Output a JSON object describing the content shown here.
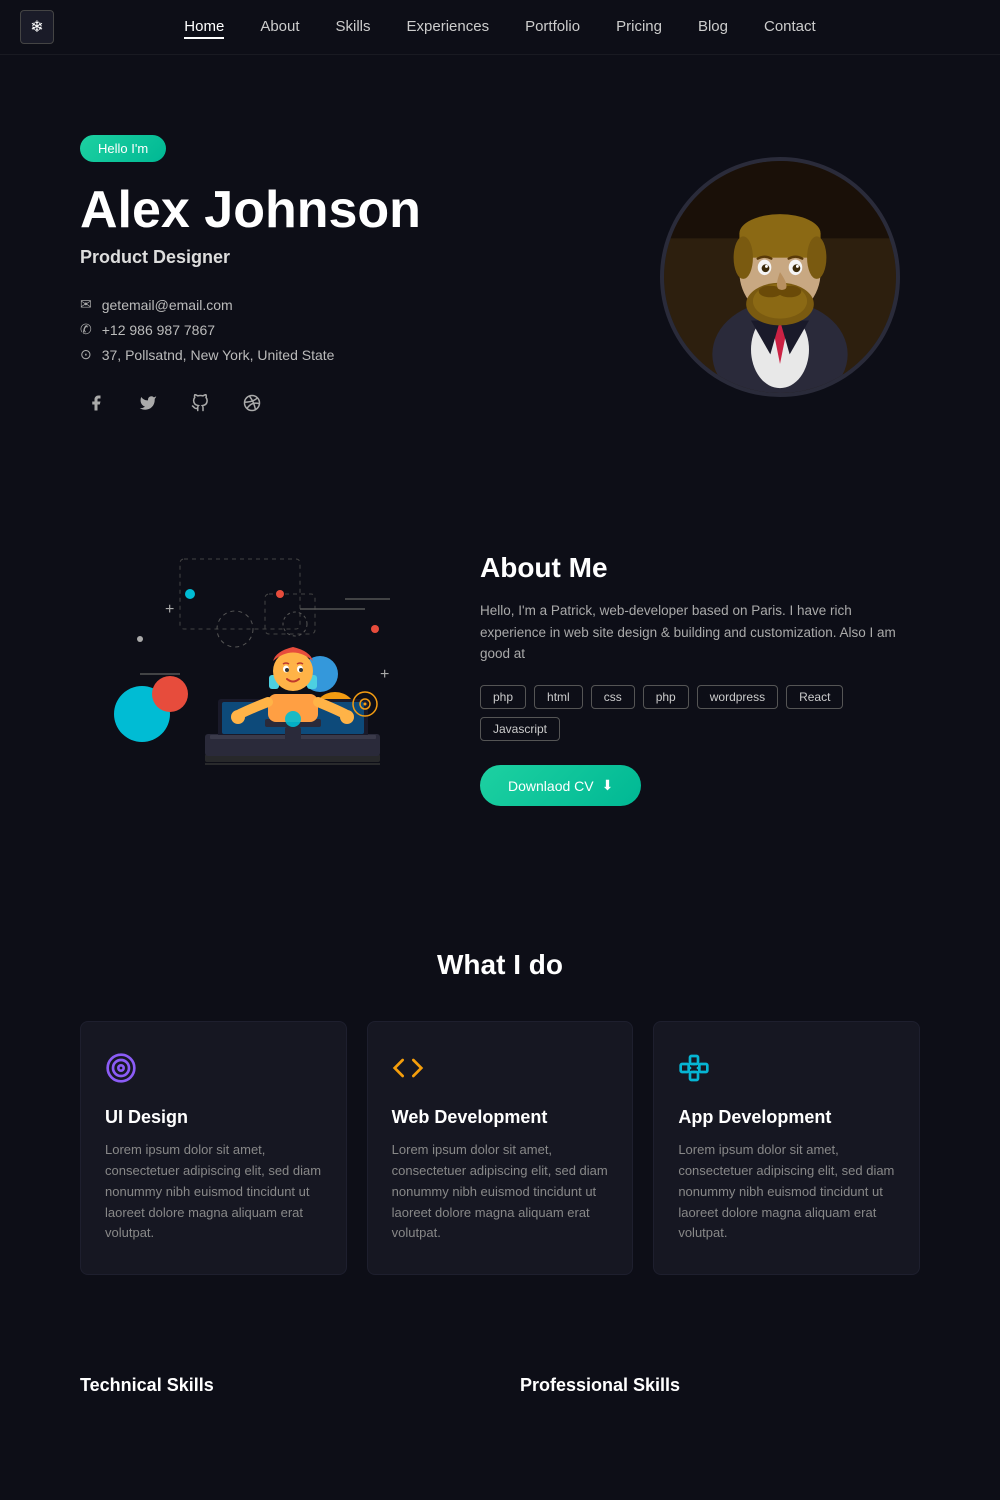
{
  "nav": {
    "logo_icon": "❄",
    "items": [
      {
        "label": "Home",
        "active": true
      },
      {
        "label": "About",
        "active": false
      },
      {
        "label": "Skills",
        "active": false
      },
      {
        "label": "Experiences",
        "active": false
      },
      {
        "label": "Portfolio",
        "active": false
      },
      {
        "label": "Pricing",
        "active": false
      },
      {
        "label": "Blog",
        "active": false
      },
      {
        "label": "Contact",
        "active": false
      }
    ]
  },
  "hero": {
    "badge": "Hello I'm",
    "name": "Alex Johnson",
    "title": "Product Designer",
    "email": "getemail@email.com",
    "phone": "+12 986 987 7867",
    "address": "37, Pollsatnd, New York, United State",
    "socials": [
      {
        "name": "facebook",
        "symbol": "f"
      },
      {
        "name": "twitter",
        "symbol": "t"
      },
      {
        "name": "github",
        "symbol": "g"
      },
      {
        "name": "dribbble",
        "symbol": "d"
      }
    ]
  },
  "about": {
    "heading": "About Me",
    "description": "Hello, I'm a Patrick, web-developer based on Paris. I have rich experience in web site design & building and customization. Also I am good at",
    "skills": [
      "php",
      "html",
      "css",
      "php",
      "wordpress",
      "React",
      "Javascript"
    ],
    "download_label": "Downlaod CV"
  },
  "what_i_do": {
    "heading": "What I do",
    "services": [
      {
        "icon": "⊙",
        "title": "UI Design",
        "description": "Lorem ipsum dolor sit amet, consectetuer adipiscing elit, sed diam nonummy nibh euismod tincidunt ut laoreet dolore magna aliquam erat volutpat."
      },
      {
        "icon": "</>",
        "title": "Web Development",
        "description": "Lorem ipsum dolor sit amet, consectetuer adipiscing elit, sed diam nonummy nibh euismod tincidunt ut laoreet dolore magna aliquam erat volutpat."
      },
      {
        "icon": "⊞",
        "title": "App Development",
        "description": "Lorem ipsum dolor sit amet, consectetuer adipiscing elit, sed diam nonummy nibh euismod tincidunt ut laoreet dolore magna aliquam erat volutpat."
      }
    ]
  },
  "skills_teaser": {
    "col1": "Technical Skills",
    "col2": "Professional Skills"
  },
  "colors": {
    "accent": "#1dd1a1",
    "bg": "#0d0e17",
    "card_bg": "#161722",
    "text_muted": "#888888"
  }
}
